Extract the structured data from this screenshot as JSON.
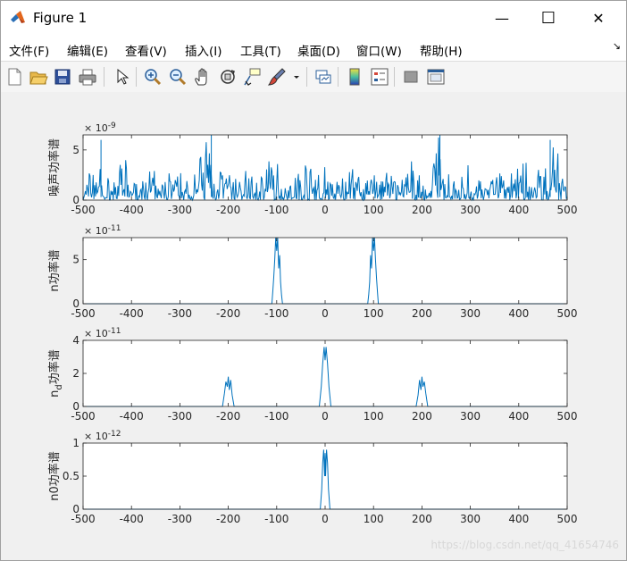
{
  "window": {
    "title": "Figure 1",
    "minimize_glyph": "—",
    "maximize_glyph": "☐",
    "close_glyph": "✕",
    "undock_glyph": "↘"
  },
  "menu": [
    "文件(F)",
    "编辑(E)",
    "查看(V)",
    "插入(I)",
    "工具(T)",
    "桌面(D)",
    "窗口(W)",
    "帮助(H)"
  ],
  "toolbar_icons": [
    "new-figure-icon",
    "open-file-icon",
    "save-icon",
    "print-icon",
    "select-arrow-icon",
    "zoom-in-icon",
    "zoom-out-icon",
    "pan-hand-icon",
    "rotate-3d-icon",
    "data-cursor-icon",
    "brush-icon",
    "brush-dropdown-icon",
    "link-plot-icon",
    "colorbar-icon",
    "legend-icon",
    "hide-plot-tools-icon",
    "show-plot-tools-icon"
  ],
  "watermark": "https://blog.csdn.net/qq_41654746",
  "colors": {
    "line": "#0072bd"
  },
  "chart_data": [
    {
      "type": "line",
      "title": "",
      "xlabel": "",
      "ylabel": "噪声功率谱",
      "exponent": "× 10^-9",
      "xlim": [
        -500,
        500
      ],
      "ylim": [
        0,
        6.5
      ],
      "xticks": [
        -500,
        -400,
        -300,
        -200,
        -100,
        0,
        100,
        200,
        300,
        400,
        500
      ],
      "yticks": [
        0,
        5
      ],
      "description_of_series": "dense random noise spectrum across full range, mostly 0-2.5, spikes up to ~6.5",
      "series": [
        {
          "x": [
            -500,
            -490,
            -470,
            -460,
            -440,
            -420,
            -400,
            -380,
            -360,
            -340,
            -320,
            -300,
            -280,
            -260,
            -240,
            -230,
            -220,
            -200,
            -180,
            -160,
            -140,
            -120,
            -100,
            -80,
            -60,
            -40,
            -20,
            0,
            20,
            40,
            60,
            80,
            100,
            120,
            140,
            160,
            180,
            200,
            220,
            240,
            260,
            280,
            300,
            320,
            340,
            360,
            380,
            400,
            420,
            440,
            460,
            470,
            490,
            500
          ],
          "y": [
            1.0,
            2.5,
            6.0,
            2.2,
            1.8,
            3.5,
            2.0,
            1.5,
            2.8,
            1.2,
            3.0,
            2.4,
            1.6,
            4.2,
            6.5,
            2.0,
            3.5,
            2.6,
            2.2,
            2.9,
            1.7,
            3.8,
            3.2,
            1.5,
            2.4,
            3.6,
            2.2,
            3.0,
            1.4,
            2.8,
            3.5,
            1.9,
            4.2,
            3.0,
            2.0,
            2.7,
            3.4,
            1.8,
            2.5,
            6.5,
            2.9,
            1.6,
            3.3,
            2.1,
            2.7,
            3.1,
            1.8,
            4.5,
            2.2,
            3.0,
            2.6,
            6.0,
            2.0,
            1.5
          ]
        }
      ]
    },
    {
      "type": "line",
      "title": "",
      "xlabel": "",
      "ylabel": "n功率谱",
      "exponent": "× 10^-11",
      "xlim": [
        -500,
        500
      ],
      "ylim": [
        0,
        7.5
      ],
      "xticks": [
        -500,
        -400,
        -300,
        -200,
        -100,
        0,
        100,
        200,
        300,
        400,
        500
      ],
      "yticks": [
        0,
        5
      ],
      "series": [
        {
          "x": [
            -500,
            -110,
            -108,
            -106,
            -104,
            -102,
            -100,
            -98,
            -96,
            -94,
            -92,
            -90,
            -88,
            0,
            88,
            90,
            92,
            94,
            96,
            98,
            100,
            102,
            104,
            106,
            108,
            110,
            500
          ],
          "y": [
            0,
            0,
            1.5,
            3.0,
            5.0,
            7.5,
            6.0,
            7.5,
            4.0,
            5.5,
            2.5,
            1.0,
            0,
            0,
            0,
            1.0,
            2.5,
            5.5,
            4.0,
            7.5,
            6.0,
            7.5,
            5.0,
            3.0,
            1.5,
            0,
            0
          ]
        }
      ]
    },
    {
      "type": "line",
      "title": "",
      "xlabel": "",
      "ylabel": "n_d功率谱",
      "exponent": "× 10^-11",
      "xlim": [
        -500,
        500
      ],
      "ylim": [
        0,
        4
      ],
      "xticks": [
        -500,
        -400,
        -300,
        -200,
        -100,
        0,
        100,
        200,
        300,
        400,
        500
      ],
      "yticks": [
        0,
        2,
        4
      ],
      "series": [
        {
          "x": [
            -500,
            -212,
            -208,
            -205,
            -202,
            -200,
            -198,
            -195,
            -192,
            -188,
            -12,
            -8,
            -5,
            -2,
            0,
            2,
            5,
            8,
            12,
            188,
            192,
            195,
            198,
            200,
            202,
            205,
            208,
            212,
            500
          ],
          "y": [
            0,
            0,
            0.8,
            1.5,
            1.2,
            1.8,
            1.0,
            1.6,
            0.7,
            0,
            0,
            1.2,
            2.6,
            3.6,
            2.8,
            3.6,
            2.6,
            1.2,
            0,
            0,
            0.7,
            1.6,
            1.0,
            1.8,
            1.2,
            1.5,
            0.8,
            0,
            0
          ]
        }
      ]
    },
    {
      "type": "line",
      "title": "",
      "xlabel": "",
      "ylabel": "n0功率谱",
      "exponent": "× 10^-12",
      "xlim": [
        -500,
        500
      ],
      "ylim": [
        0,
        1
      ],
      "xticks": [
        -500,
        -400,
        -300,
        -200,
        -100,
        0,
        100,
        200,
        300,
        400,
        500
      ],
      "yticks": [
        0,
        0.5,
        1
      ],
      "series": [
        {
          "x": [
            -500,
            -10,
            -7,
            -5,
            -3,
            -1,
            0,
            1,
            3,
            5,
            7,
            10,
            500
          ],
          "y": [
            0,
            0,
            0.3,
            0.7,
            0.9,
            0.5,
            0.85,
            0.5,
            0.9,
            0.7,
            0.3,
            0,
            0
          ]
        }
      ]
    }
  ]
}
